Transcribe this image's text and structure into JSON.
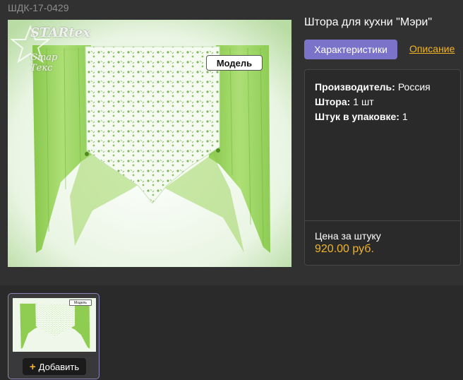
{
  "product": {
    "sku": "ШДК-17-0429",
    "title": "Штора для кухни \"Мэри\"",
    "image_badge": "Модель",
    "logo_text": "STARtex",
    "logo_subtext": "Стар Текс"
  },
  "tabs": {
    "active_label": "Характеристики",
    "link_label": "Описание"
  },
  "specs": [
    {
      "key": "Производитель:",
      "value": "Россия"
    },
    {
      "key": "Штора:",
      "value": "1 шт"
    },
    {
      "key": "Штук в упаковке:",
      "value": "1"
    }
  ],
  "price": {
    "label": "Цена за штуку",
    "value": "920.00 руб."
  },
  "thumbnail": {
    "badge": "Модель",
    "add_label": "Добавить",
    "add_icon": "plus-icon"
  },
  "colors": {
    "accent_tab": "#7b73c9",
    "price": "#f0b425",
    "curtain_green": "#8bd14a"
  }
}
